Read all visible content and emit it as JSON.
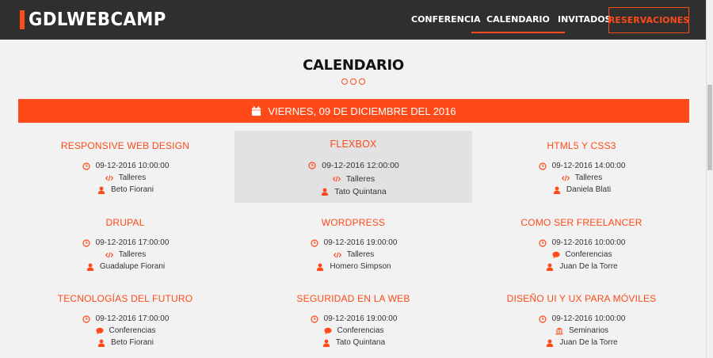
{
  "nav": {
    "logo": "GDLWEBCAMP",
    "items": [
      "CONFERENCIA",
      "CALENDARIO",
      "INVITADOS"
    ],
    "cta": "RESERVACIONES"
  },
  "section": {
    "title": "CALENDARIO"
  },
  "date_header": "VIERNES, 09 DE DICIEMBRE DEL 2016",
  "events": [
    {
      "title": "RESPONSIVE WEB DESIGN",
      "datetime": "09-12-2016 10:00:00",
      "category": "Talleres",
      "category_icon": "code-icon",
      "speaker": "Beto Fiorani"
    },
    {
      "title": "FLEXBOX",
      "datetime": "09-12-2016 12:00:00",
      "category": "Talleres",
      "category_icon": "code-icon",
      "speaker": "Tato Quintana"
    },
    {
      "title": "HTML5 Y CSS3",
      "datetime": "09-12-2016 14:00:00",
      "category": "Talleres",
      "category_icon": "code-icon",
      "speaker": "Daniela Blati"
    },
    {
      "title": "DRUPAL",
      "datetime": "09-12-2016 17:00:00",
      "category": "Talleres",
      "category_icon": "code-icon",
      "speaker": "Guadalupe Fiorani"
    },
    {
      "title": "WORDPRESS",
      "datetime": "09-12-2016 19:00:00",
      "category": "Talleres",
      "category_icon": "code-icon",
      "speaker": "Homero Simpson"
    },
    {
      "title": "COMO SER FREELANCER",
      "datetime": "09-12-2016 10:00:00",
      "category": "Conferencias",
      "category_icon": "comment-icon",
      "speaker": "Juan De la Torre"
    },
    {
      "title": "TECNOLOGÍAS DEL FUTURO",
      "datetime": "09-12-2016 17:00:00",
      "category": "Conferencias",
      "category_icon": "comment-icon",
      "speaker": "Beto Fiorani"
    },
    {
      "title": "SEGURIDAD EN LA WEB",
      "datetime": "09-12-2016 19:00:00",
      "category": "Conferencias",
      "category_icon": "comment-icon",
      "speaker": "Tato Quintana"
    },
    {
      "title": "DISEÑO UI Y UX PARA MÓVILES",
      "datetime": "09-12-2016 10:00:00",
      "category": "Seminarios",
      "category_icon": "university-icon",
      "speaker": "Juan De la Torre"
    }
  ],
  "colors": {
    "accent": "#fe4918",
    "navbar": "#2f2f2f",
    "background": "#f2f2f2",
    "highlight": "#e2e2e2"
  }
}
